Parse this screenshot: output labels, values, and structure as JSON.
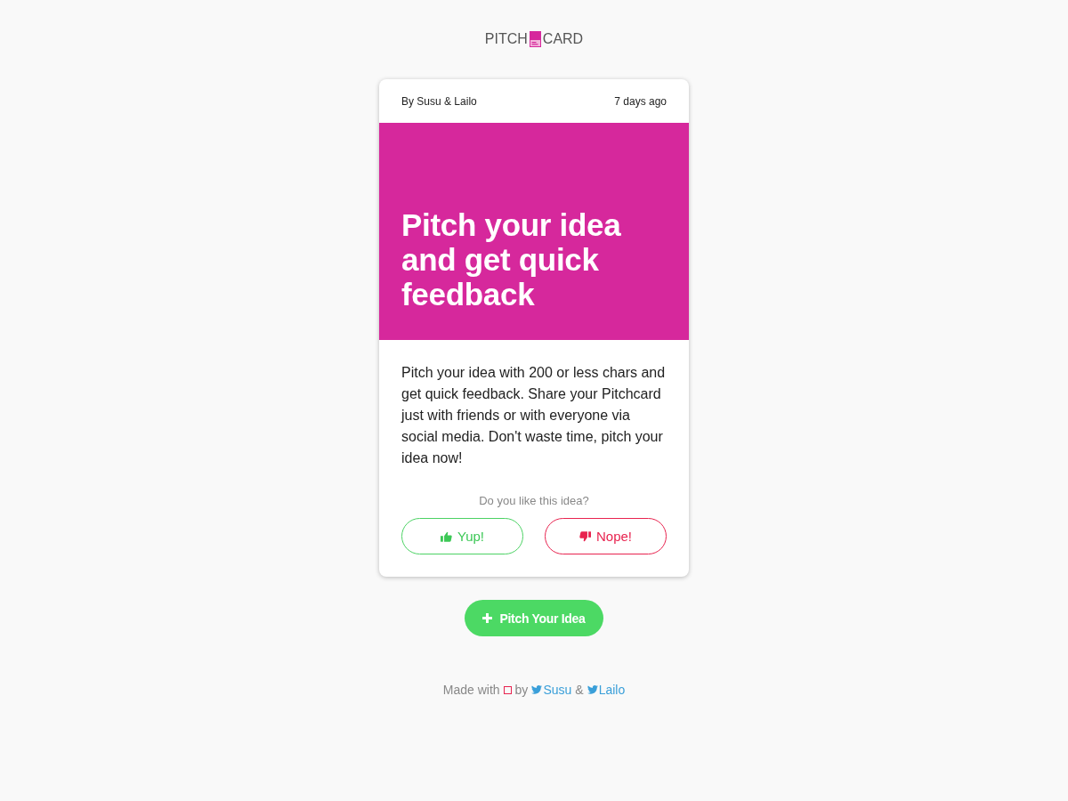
{
  "logo": {
    "left": "PITCH",
    "right": "CARD"
  },
  "card": {
    "author": "By Susu & Lailo",
    "time": "7 days ago",
    "headline": "Pitch your idea and get quick feedback",
    "body": "Pitch your idea with 200 or less chars and get quick feedback. Share your Pitchcard just with friends or with everyone via social media. Don't waste time, pitch your idea now!",
    "question": "Do you like this idea?",
    "votes": [
      {
        "kind": "up",
        "label": "Yup!"
      },
      {
        "kind": "down",
        "label": "Nope!"
      }
    ]
  },
  "pitch_button": "Pitch Your Idea",
  "footer": {
    "made_with": "Made with",
    "by": "by",
    "and": "&",
    "links": [
      "Susu",
      "Lailo"
    ]
  }
}
